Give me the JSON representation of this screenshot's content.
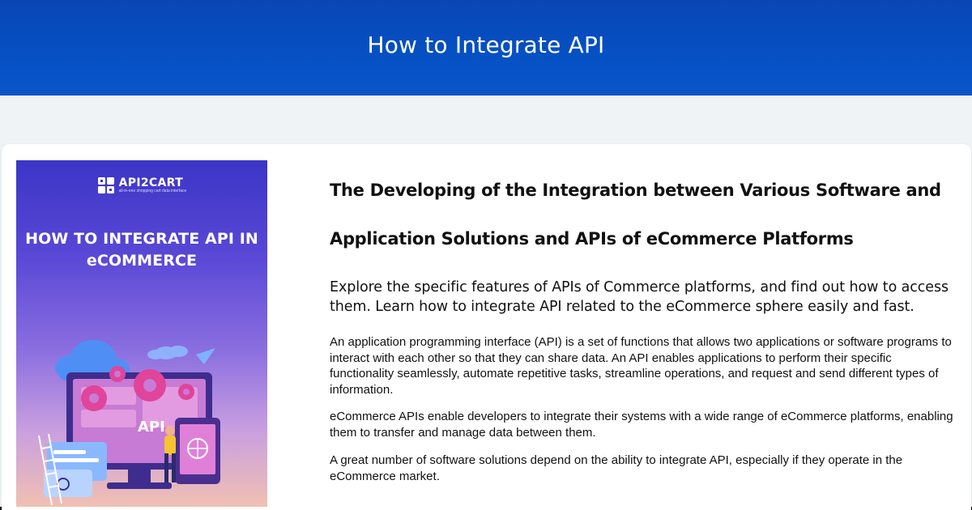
{
  "header": {
    "title": "How to Integrate API"
  },
  "cover": {
    "brand_name": "API2CART",
    "brand_tagline": "all-in-one shopping cart data interface",
    "title": "HOW TO INTEGRATE API IN eCOMMERCE",
    "illustration_label": "API",
    "colors": {
      "top": "#3b35c6",
      "bottom": "#f1c0b2"
    }
  },
  "article": {
    "heading": "The Developing of the Integration between Various Software and Application Solutions and APIs of eCommerce Platforms",
    "lead": "Explore the specific features of APIs of Commerce platforms, and find out how to access them. Learn how to integrate API related to the eCommerce sphere easily and fast.",
    "paragraphs": [
      "An application programming interface (API) is a set of functions that allows two applications or software programs to interact with each other so that they can share data. An API enables applications to perform their specific functionality seamlessly, automate repetitive tasks, streamline operations, and request and send different types of information.",
      "eCommerce APIs enable developers to integrate their systems with a wide range of eCommerce platforms, enabling them to transfer and manage data between them.",
      "A great number of software solutions depend on the ability to integrate API, especially if they operate in the eCommerce market."
    ]
  },
  "colors": {
    "header": "#0551c4",
    "background": "#eff3f6",
    "text": "#111111"
  }
}
